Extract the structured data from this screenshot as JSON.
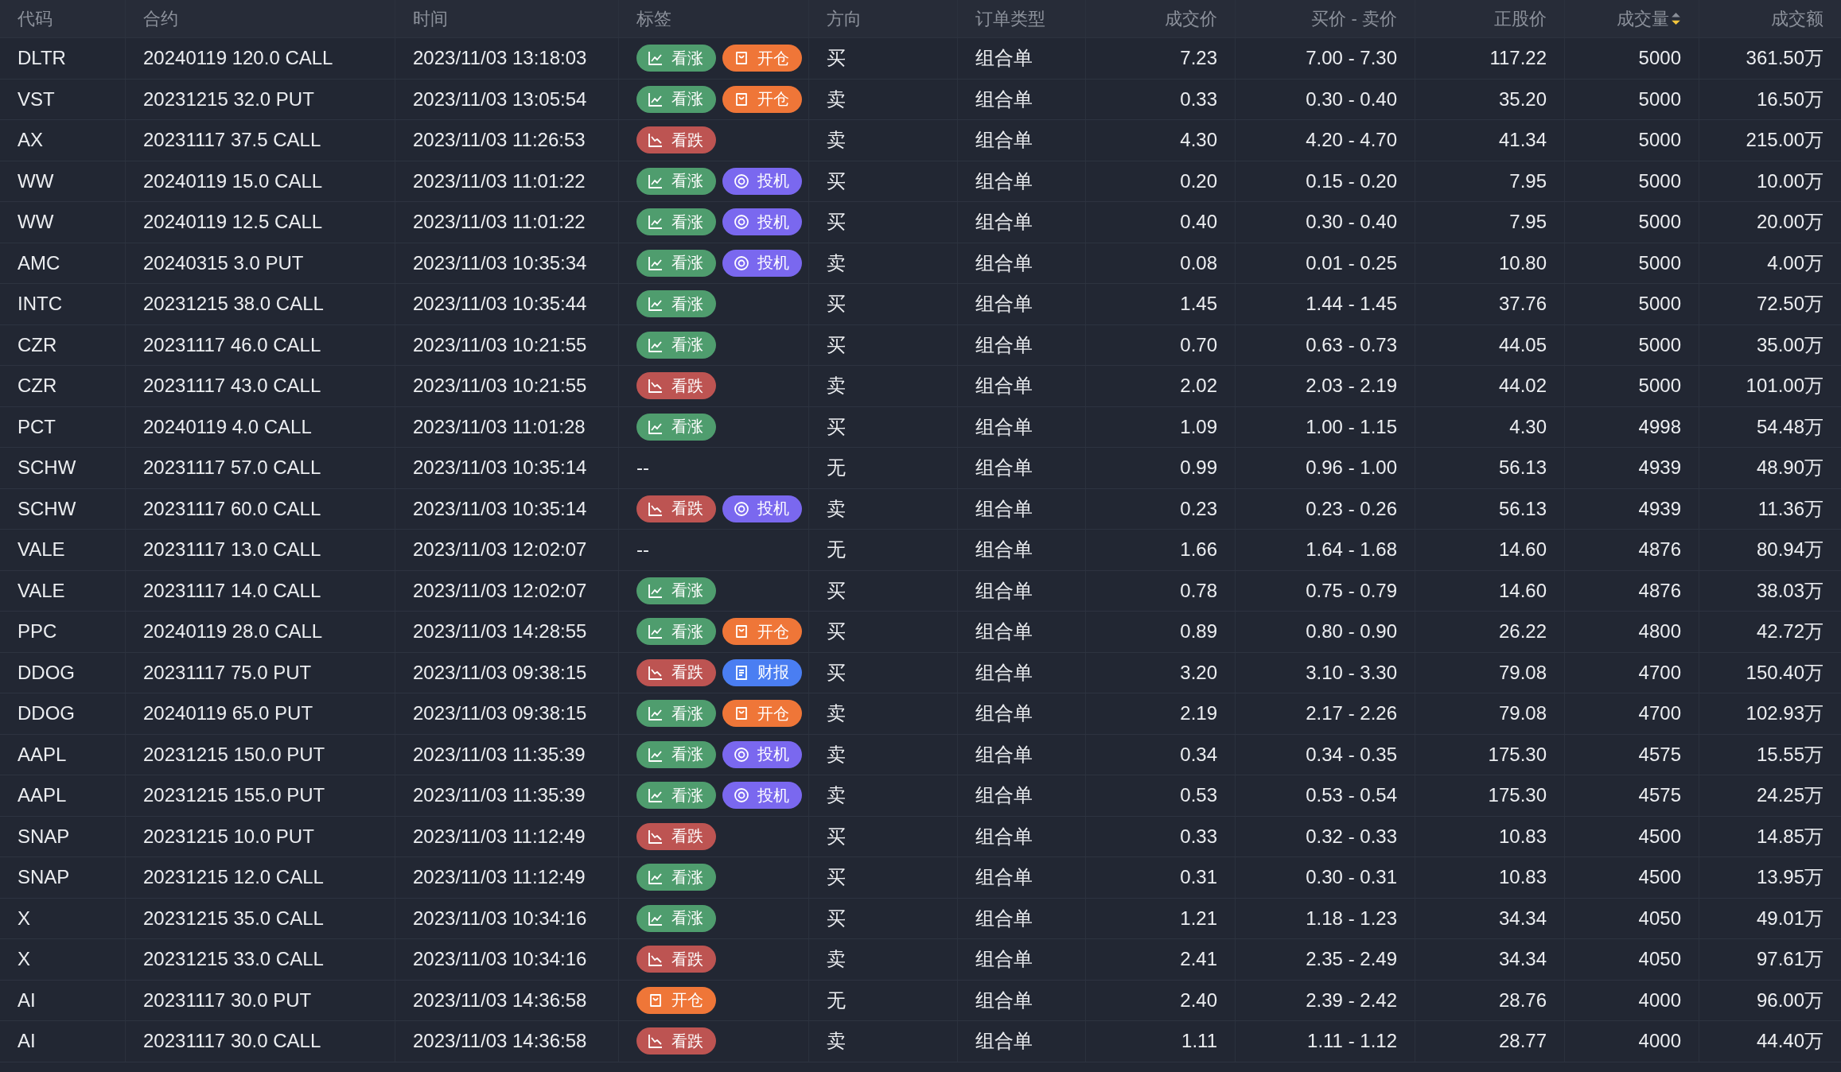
{
  "table": {
    "columns": [
      {
        "label": "代码",
        "sorted": false
      },
      {
        "label": "合约",
        "sorted": false
      },
      {
        "label": "时间",
        "sorted": false
      },
      {
        "label": "标签",
        "sorted": false
      },
      {
        "label": "方向",
        "sorted": false
      },
      {
        "label": "订单类型",
        "sorted": false
      },
      {
        "label": "成交价",
        "sorted": false
      },
      {
        "label": "买价 - 卖价",
        "sorted": false
      },
      {
        "label": "正股价",
        "sorted": false
      },
      {
        "label": "成交量",
        "sorted": true
      },
      {
        "label": "成交额",
        "sorted": false
      }
    ],
    "rows": [
      {
        "code": "DLTR",
        "contract": "20240119 120.0 CALL",
        "time": "2023/11/03 13:18:03",
        "tags": [
          {
            "kind": "bullish",
            "label": "看涨"
          },
          {
            "kind": "open",
            "label": "开仓"
          }
        ],
        "direction": "买",
        "order_type": "组合单",
        "price": "7.23",
        "bid_ask": "7.00 - 7.30",
        "stock_price": "117.22",
        "volume": "5000",
        "amount": "361.50万"
      },
      {
        "code": "VST",
        "contract": "20231215 32.0 PUT",
        "time": "2023/11/03 13:05:54",
        "tags": [
          {
            "kind": "bullish",
            "label": "看涨"
          },
          {
            "kind": "open",
            "label": "开仓"
          }
        ],
        "direction": "卖",
        "order_type": "组合单",
        "price": "0.33",
        "bid_ask": "0.30 - 0.40",
        "stock_price": "35.20",
        "volume": "5000",
        "amount": "16.50万"
      },
      {
        "code": "AX",
        "contract": "20231117 37.5 CALL",
        "time": "2023/11/03 11:26:53",
        "tags": [
          {
            "kind": "bearish",
            "label": "看跌"
          }
        ],
        "direction": "卖",
        "order_type": "组合单",
        "price": "4.30",
        "bid_ask": "4.20 - 4.70",
        "stock_price": "41.34",
        "volume": "5000",
        "amount": "215.00万"
      },
      {
        "code": "WW",
        "contract": "20240119 15.0 CALL",
        "time": "2023/11/03 11:01:22",
        "tags": [
          {
            "kind": "bullish",
            "label": "看涨"
          },
          {
            "kind": "speculative",
            "label": "投机"
          }
        ],
        "direction": "买",
        "order_type": "组合单",
        "price": "0.20",
        "bid_ask": "0.15 - 0.20",
        "stock_price": "7.95",
        "volume": "5000",
        "amount": "10.00万"
      },
      {
        "code": "WW",
        "contract": "20240119 12.5 CALL",
        "time": "2023/11/03 11:01:22",
        "tags": [
          {
            "kind": "bullish",
            "label": "看涨"
          },
          {
            "kind": "speculative",
            "label": "投机"
          }
        ],
        "direction": "买",
        "order_type": "组合单",
        "price": "0.40",
        "bid_ask": "0.30 - 0.40",
        "stock_price": "7.95",
        "volume": "5000",
        "amount": "20.00万"
      },
      {
        "code": "AMC",
        "contract": "20240315 3.0 PUT",
        "time": "2023/11/03 10:35:34",
        "tags": [
          {
            "kind": "bullish",
            "label": "看涨"
          },
          {
            "kind": "speculative",
            "label": "投机"
          }
        ],
        "direction": "卖",
        "order_type": "组合单",
        "price": "0.08",
        "bid_ask": "0.01 - 0.25",
        "stock_price": "10.80",
        "volume": "5000",
        "amount": "4.00万"
      },
      {
        "code": "INTC",
        "contract": "20231215 38.0 CALL",
        "time": "2023/11/03 10:35:44",
        "tags": [
          {
            "kind": "bullish",
            "label": "看涨"
          }
        ],
        "direction": "买",
        "order_type": "组合单",
        "price": "1.45",
        "bid_ask": "1.44 - 1.45",
        "stock_price": "37.76",
        "volume": "5000",
        "amount": "72.50万"
      },
      {
        "code": "CZR",
        "contract": "20231117 46.0 CALL",
        "time": "2023/11/03 10:21:55",
        "tags": [
          {
            "kind": "bullish",
            "label": "看涨"
          }
        ],
        "direction": "买",
        "order_type": "组合单",
        "price": "0.70",
        "bid_ask": "0.63 - 0.73",
        "stock_price": "44.05",
        "volume": "5000",
        "amount": "35.00万"
      },
      {
        "code": "CZR",
        "contract": "20231117 43.0 CALL",
        "time": "2023/11/03 10:21:55",
        "tags": [
          {
            "kind": "bearish",
            "label": "看跌"
          }
        ],
        "direction": "卖",
        "order_type": "组合单",
        "price": "2.02",
        "bid_ask": "2.03 - 2.19",
        "stock_price": "44.02",
        "volume": "5000",
        "amount": "101.00万"
      },
      {
        "code": "PCT",
        "contract": "20240119 4.0 CALL",
        "time": "2023/11/03 11:01:28",
        "tags": [
          {
            "kind": "bullish",
            "label": "看涨"
          }
        ],
        "direction": "买",
        "order_type": "组合单",
        "price": "1.09",
        "bid_ask": "1.00 - 1.15",
        "stock_price": "4.30",
        "volume": "4998",
        "amount": "54.48万"
      },
      {
        "code": "SCHW",
        "contract": "20231117 57.0 CALL",
        "time": "2023/11/03 10:35:14",
        "tags_empty": "--",
        "direction": "无",
        "order_type": "组合单",
        "price": "0.99",
        "bid_ask": "0.96 - 1.00",
        "stock_price": "56.13",
        "volume": "4939",
        "amount": "48.90万"
      },
      {
        "code": "SCHW",
        "contract": "20231117 60.0 CALL",
        "time": "2023/11/03 10:35:14",
        "tags": [
          {
            "kind": "bearish",
            "label": "看跌"
          },
          {
            "kind": "speculative",
            "label": "投机"
          }
        ],
        "direction": "卖",
        "order_type": "组合单",
        "price": "0.23",
        "bid_ask": "0.23 - 0.26",
        "stock_price": "56.13",
        "volume": "4939",
        "amount": "11.36万"
      },
      {
        "code": "VALE",
        "contract": "20231117 13.0 CALL",
        "time": "2023/11/03 12:02:07",
        "tags_empty": "--",
        "direction": "无",
        "order_type": "组合单",
        "price": "1.66",
        "bid_ask": "1.64 - 1.68",
        "stock_price": "14.60",
        "volume": "4876",
        "amount": "80.94万"
      },
      {
        "code": "VALE",
        "contract": "20231117 14.0 CALL",
        "time": "2023/11/03 12:02:07",
        "tags": [
          {
            "kind": "bullish",
            "label": "看涨"
          }
        ],
        "direction": "买",
        "order_type": "组合单",
        "price": "0.78",
        "bid_ask": "0.75 - 0.79",
        "stock_price": "14.60",
        "volume": "4876",
        "amount": "38.03万"
      },
      {
        "code": "PPC",
        "contract": "20240119 28.0 CALL",
        "time": "2023/11/03 14:28:55",
        "tags": [
          {
            "kind": "bullish",
            "label": "看涨"
          },
          {
            "kind": "open",
            "label": "开仓"
          }
        ],
        "direction": "买",
        "order_type": "组合单",
        "price": "0.89",
        "bid_ask": "0.80 - 0.90",
        "stock_price": "26.22",
        "volume": "4800",
        "amount": "42.72万"
      },
      {
        "code": "DDOG",
        "contract": "20231117 75.0 PUT",
        "time": "2023/11/03 09:38:15",
        "tags": [
          {
            "kind": "bearish",
            "label": "看跌"
          },
          {
            "kind": "earnings",
            "label": "财报"
          }
        ],
        "direction": "买",
        "order_type": "组合单",
        "price": "3.20",
        "bid_ask": "3.10 - 3.30",
        "stock_price": "79.08",
        "volume": "4700",
        "amount": "150.40万"
      },
      {
        "code": "DDOG",
        "contract": "20240119 65.0 PUT",
        "time": "2023/11/03 09:38:15",
        "tags": [
          {
            "kind": "bullish",
            "label": "看涨"
          },
          {
            "kind": "open",
            "label": "开仓"
          }
        ],
        "direction": "卖",
        "order_type": "组合单",
        "price": "2.19",
        "bid_ask": "2.17 - 2.26",
        "stock_price": "79.08",
        "volume": "4700",
        "amount": "102.93万"
      },
      {
        "code": "AAPL",
        "contract": "20231215 150.0 PUT",
        "time": "2023/11/03 11:35:39",
        "tags": [
          {
            "kind": "bullish",
            "label": "看涨"
          },
          {
            "kind": "speculative",
            "label": "投机"
          }
        ],
        "direction": "卖",
        "order_type": "组合单",
        "price": "0.34",
        "bid_ask": "0.34 - 0.35",
        "stock_price": "175.30",
        "volume": "4575",
        "amount": "15.55万"
      },
      {
        "code": "AAPL",
        "contract": "20231215 155.0 PUT",
        "time": "2023/11/03 11:35:39",
        "tags": [
          {
            "kind": "bullish",
            "label": "看涨"
          },
          {
            "kind": "speculative",
            "label": "投机"
          }
        ],
        "direction": "卖",
        "order_type": "组合单",
        "price": "0.53",
        "bid_ask": "0.53 - 0.54",
        "stock_price": "175.30",
        "volume": "4575",
        "amount": "24.25万"
      },
      {
        "code": "SNAP",
        "contract": "20231215 10.0 PUT",
        "time": "2023/11/03 11:12:49",
        "tags": [
          {
            "kind": "bearish",
            "label": "看跌"
          }
        ],
        "direction": "买",
        "order_type": "组合单",
        "price": "0.33",
        "bid_ask": "0.32 - 0.33",
        "stock_price": "10.83",
        "volume": "4500",
        "amount": "14.85万"
      },
      {
        "code": "SNAP",
        "contract": "20231215 12.0 CALL",
        "time": "2023/11/03 11:12:49",
        "tags": [
          {
            "kind": "bullish",
            "label": "看涨"
          }
        ],
        "direction": "买",
        "order_type": "组合单",
        "price": "0.31",
        "bid_ask": "0.30 - 0.31",
        "stock_price": "10.83",
        "volume": "4500",
        "amount": "13.95万"
      },
      {
        "code": "X",
        "contract": "20231215 35.0 CALL",
        "time": "2023/11/03 10:34:16",
        "tags": [
          {
            "kind": "bullish",
            "label": "看涨"
          }
        ],
        "direction": "买",
        "order_type": "组合单",
        "price": "1.21",
        "bid_ask": "1.18 - 1.23",
        "stock_price": "34.34",
        "volume": "4050",
        "amount": "49.01万"
      },
      {
        "code": "X",
        "contract": "20231215 33.0 CALL",
        "time": "2023/11/03 10:34:16",
        "tags": [
          {
            "kind": "bearish",
            "label": "看跌"
          }
        ],
        "direction": "卖",
        "order_type": "组合单",
        "price": "2.41",
        "bid_ask": "2.35 - 2.49",
        "stock_price": "34.34",
        "volume": "4050",
        "amount": "97.61万"
      },
      {
        "code": "AI",
        "contract": "20231117 30.0 PUT",
        "time": "2023/11/03 14:36:58",
        "tags": [
          {
            "kind": "open",
            "label": "开仓"
          }
        ],
        "direction": "无",
        "order_type": "组合单",
        "price": "2.40",
        "bid_ask": "2.39 - 2.42",
        "stock_price": "28.76",
        "volume": "4000",
        "amount": "96.00万"
      },
      {
        "code": "AI",
        "contract": "20231117 30.0 CALL",
        "time": "2023/11/03 14:36:58",
        "tags": [
          {
            "kind": "bearish",
            "label": "看跌"
          }
        ],
        "direction": "卖",
        "order_type": "组合单",
        "price": "1.11",
        "bid_ask": "1.11 - 1.12",
        "stock_price": "28.77",
        "volume": "4000",
        "amount": "44.40万"
      }
    ]
  }
}
